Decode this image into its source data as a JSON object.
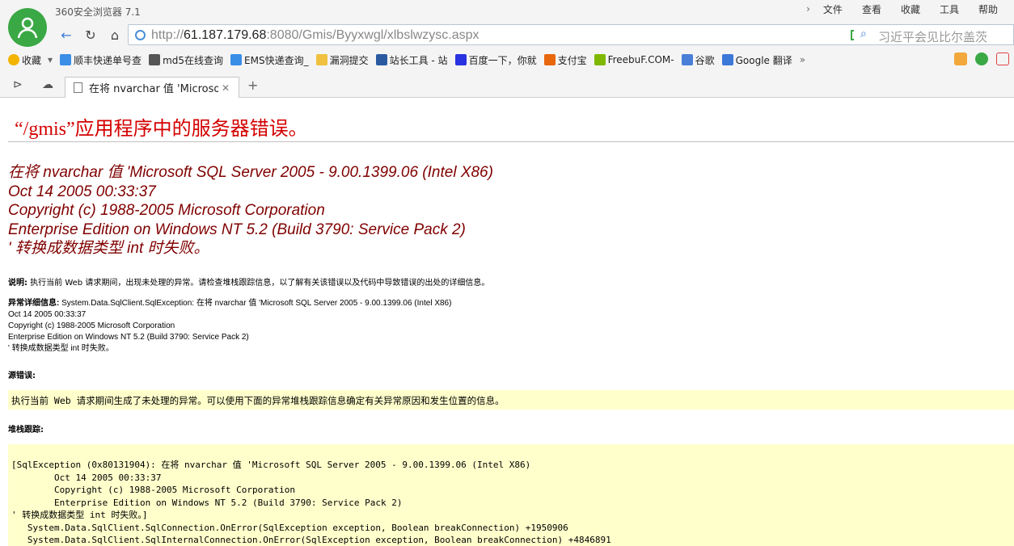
{
  "window": {
    "app_title": "360安全浏览器 7.1"
  },
  "menu": {
    "items": [
      "文件",
      "查看",
      "收藏",
      "工具",
      "帮助"
    ]
  },
  "address": {
    "scheme": "http://",
    "host": "61.187.179.68",
    "rest": ":8080/Gmis/Byyxwgl/xlbslwzysc.aspx"
  },
  "search": {
    "placeholder": "习近平会见比尔盖茨"
  },
  "bookmarks": [
    {
      "label": "收藏",
      "icon": "star-icon"
    },
    {
      "label": "顺丰快递单号查",
      "icon": "ie-icon"
    },
    {
      "label": "md5在线查询",
      "icon": "grid-icon"
    },
    {
      "label": "EMS快递查询_",
      "icon": "ie-icon"
    },
    {
      "label": "漏洞提交",
      "icon": "folder-icon"
    },
    {
      "label": "站长工具 - 站",
      "icon": "site-icon"
    },
    {
      "label": "百度一下，你就",
      "icon": "baidu-icon"
    },
    {
      "label": "支付宝",
      "icon": "alipay-icon"
    },
    {
      "label": "FreebuF.COM-",
      "icon": "freebuf-icon"
    },
    {
      "label": "谷歌",
      "icon": "google-icon"
    },
    {
      "label": "Google 翻译",
      "icon": "translate-icon"
    }
  ],
  "tab": {
    "title": "在将 nvarchar 值 'Microsoft S"
  },
  "error": {
    "heading": "“/gmis”应用程序中的服务器错误。",
    "title_lines": [
      "在将 nvarchar 值 'Microsoft SQL Server 2005 - 9.00.1399.06 (Intel X86)",
      "Oct 14 2005 00:33:37",
      "Copyright (c) 1988-2005 Microsoft Corporation",
      "Enterprise Edition on Windows NT 5.2 (Build 3790: Service Pack 2)",
      "' 转换成数据类型 int 时失败。"
    ],
    "desc_label": "说明:",
    "desc_text": " 执行当前 Web 请求期间，出现未处理的异常。请检查堆栈跟踪信息，以了解有关该错误以及代码中导致错误的出处的详细信息。",
    "exc_label": "异常详细信息:",
    "exc_first": " System.Data.SqlClient.SqlException: 在将 nvarchar 值 'Microsoft SQL Server 2005 - 9.00.1399.06 (Intel X86)",
    "exc_rest": "Oct 14 2005 00:33:37\nCopyright (c) 1988-2005 Microsoft Corporation\nEnterprise Edition on Windows NT 5.2 (Build 3790: Service Pack 2)\n' 转换成数据类型 int 时失败。",
    "source_label": "源错误:",
    "source_text": "执行当前 Web 请求期间生成了未处理的异常。可以使用下面的异常堆栈跟踪信息确定有关异常原因和发生位置的信息。",
    "stack_label": "堆栈跟踪:",
    "stack_text": "[SqlException (0x80131904): 在将 nvarchar 值 'Microsoft SQL Server 2005 - 9.00.1399.06 (Intel X86)\n\tOct 14 2005 00:33:37\n\tCopyright (c) 1988-2005 Microsoft Corporation\n\tEnterprise Edition on Windows NT 5.2 (Build 3790: Service Pack 2)\n' 转换成数据类型 int 时失败。]\n   System.Data.SqlClient.SqlConnection.OnError(SqlException exception, Boolean breakConnection) +1950906\n   System.Data.SqlClient.SqlInternalConnection.OnError(SqlException exception, Boolean breakConnection) +4846891"
  }
}
